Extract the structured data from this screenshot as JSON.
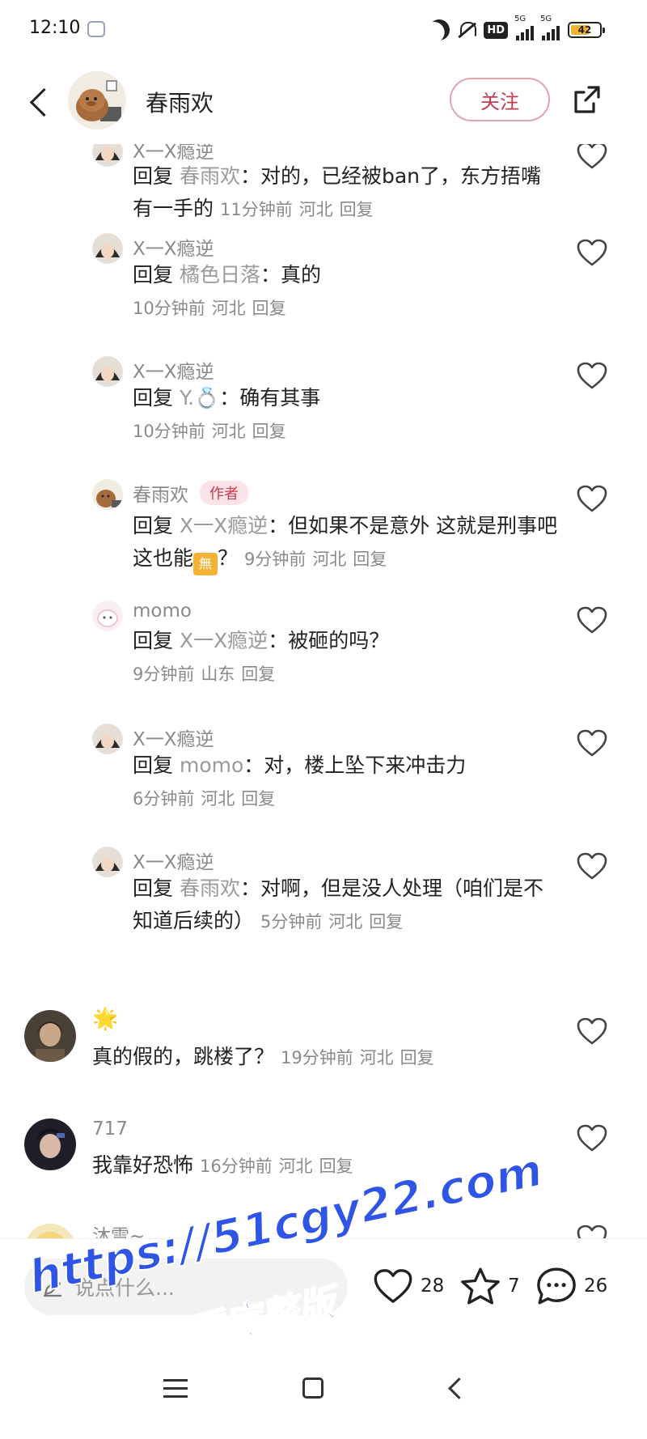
{
  "status_bar": {
    "time": "12:10",
    "hd_label": "HD",
    "signal1_label": "5G",
    "signal2_label": "5G",
    "battery": "42"
  },
  "header": {
    "author_name": "春雨欢",
    "follow_label": "关注"
  },
  "comments": [
    {
      "name": "X一X瘾逆",
      "reply_prefix": "回复",
      "mention": "春雨欢",
      "text": "：对的，已经被ban了，东方捂嘴有一手的",
      "time": "11分钟前",
      "location": "河北",
      "reply_label": "回复"
    },
    {
      "name": "X一X瘾逆",
      "reply_prefix": "回复",
      "mention": "橘色日落",
      "text": "：真的",
      "time": "10分钟前",
      "location": "河北",
      "reply_label": "回复"
    },
    {
      "name": "X一X瘾逆",
      "reply_prefix": "回复",
      "mention": "Y.💍",
      "text": "：确有其事",
      "time": "10分钟前",
      "location": "河北",
      "reply_label": "回复"
    },
    {
      "name": "春雨欢",
      "badge": "作者",
      "reply_prefix": "回复",
      "mention": "X一X瘾逆",
      "text": "：但如果不是意外 这就是刑事吧 这也能",
      "text_after": "？",
      "emoji": "無",
      "time": "9分钟前",
      "location": "河北",
      "reply_label": "回复"
    },
    {
      "name": "momo",
      "reply_prefix": "回复",
      "mention": "X一X瘾逆",
      "text": "：被砸的吗？",
      "time": "9分钟前",
      "location": "山东",
      "reply_label": "回复"
    },
    {
      "name": "X一X瘾逆",
      "reply_prefix": "回复",
      "mention": "momo",
      "text": "：对，楼上坠下来冲击力",
      "time": "6分钟前",
      "location": "河北",
      "reply_label": "回复"
    },
    {
      "name": "X一X瘾逆",
      "reply_prefix": "回复",
      "mention": "春雨欢",
      "text": "：对啊，但是没人处理（咱们是不知道后续的）",
      "time": "5分钟前",
      "location": "河北",
      "reply_label": "回复"
    },
    {
      "name": "🌟",
      "text": "真的假的，跳楼了？",
      "time": "19分钟前",
      "location": "河北",
      "reply_label": "回复"
    },
    {
      "name": "717",
      "text": "我靠好恐怖",
      "time": "16分钟前",
      "location": "河北",
      "reply_label": "回复"
    },
    {
      "name": "沐雪~"
    }
  ],
  "action_bar": {
    "input_placeholder": "说点什么...",
    "like_count": "28",
    "star_count": "7",
    "comment_count": "26"
  },
  "watermark": {
    "line1": "https://51cgy22.com",
    "line2": "看完整版"
  },
  "colors": {
    "accent": "#c63b4e",
    "watermark": "#2f55e6",
    "battery": "#f3b233"
  }
}
